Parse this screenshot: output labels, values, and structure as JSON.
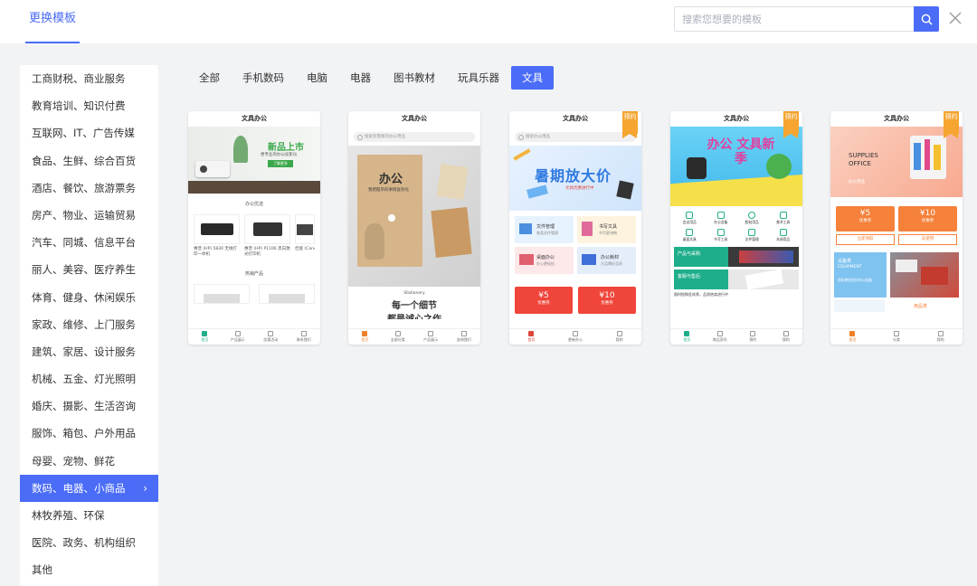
{
  "header": {
    "tab_label": "更换模板",
    "search_placeholder": "搜索您想要的模板"
  },
  "sidebar": {
    "items": [
      {
        "label": "工商财税、商业服务"
      },
      {
        "label": "教育培训、知识付费"
      },
      {
        "label": "互联网、IT、广告传媒"
      },
      {
        "label": "食品、生鲜、综合百货"
      },
      {
        "label": "酒店、餐饮、旅游票务"
      },
      {
        "label": "房产、物业、运输贸易"
      },
      {
        "label": "汽车、同城、信息平台"
      },
      {
        "label": "丽人、美容、医疗养生"
      },
      {
        "label": "体育、健身、休闲娱乐"
      },
      {
        "label": "家政、维修、上门服务"
      },
      {
        "label": "建筑、家居、设计服务"
      },
      {
        "label": "机械、五金、灯光照明"
      },
      {
        "label": "婚庆、摄影、生活咨询"
      },
      {
        "label": "服饰、箱包、户外用品"
      },
      {
        "label": "母婴、宠物、鲜花"
      },
      {
        "label": "数码、电器、小商品",
        "active": true
      },
      {
        "label": "林牧养殖、环保"
      },
      {
        "label": "医院、政务、机构组织"
      },
      {
        "label": "其他"
      }
    ]
  },
  "filters": {
    "tabs": [
      {
        "label": "全部"
      },
      {
        "label": "手机数码"
      },
      {
        "label": "电脑"
      },
      {
        "label": "电器"
      },
      {
        "label": "图书教材"
      },
      {
        "label": "玩具乐器"
      },
      {
        "label": "文具",
        "active": true
      }
    ]
  },
  "cards": [
    {
      "title": "文具办公",
      "banner_title": "新品上市",
      "banner_sub": "更专业的办公投影仪",
      "banner_btn": "了解更多",
      "section1": "办公优选",
      "products": [
        {
          "name": "惠普 (HP) 5830 无线打印一体机"
        },
        {
          "name": "惠普 (HP) P1106 黑白激光打印机"
        },
        {
          "name": "佳能 (Canon) 针式打印机"
        }
      ],
      "section2": "热销产品",
      "tabbar": [
        "首页",
        "产品展示",
        "优惠活动",
        "联系我们"
      ]
    },
    {
      "title": "文具办公",
      "search": "搜索您需要的办公用品",
      "banner_title": "办公",
      "banner_sub": "我把握单的事情复杂化",
      "tag": "Stationery",
      "caption1": "每一个细节",
      "caption2": "都是诚心之作",
      "tabbar": [
        "首页",
        "全部分类",
        "产品展示",
        "咨询我们"
      ]
    },
    {
      "title": "文具办公",
      "ribbon": "预约",
      "search": "搜索办公用品",
      "banner_title": "暑期放大价",
      "banner_sub": "文具优惠进行中",
      "grid": [
        {
          "name": "文件管理",
          "sub": "各类文件管理"
        },
        {
          "name": "书写文具",
          "sub": "书写更流畅"
        },
        {
          "name": "桌面办公",
          "sub": "办公更轻松"
        },
        {
          "name": "办公耗材",
          "sub": "大品牌好品质"
        }
      ],
      "coupons": [
        {
          "amount": "¥5",
          "label": "优惠券"
        },
        {
          "amount": "¥10",
          "label": "优惠券"
        }
      ],
      "tabbar": [
        "首页",
        "更新办公",
        "我的"
      ]
    },
    {
      "title": "文具办公",
      "ribbon": "预约",
      "banner_title": "办公 文具新季",
      "icons": [
        "会议用品",
        "办公设备",
        "胶粘用品",
        "美术工具",
        "桌面文具",
        "书写工具",
        "文件管理",
        "本册用品"
      ],
      "promo1": "产品与采购",
      "promo2": "客服与售后",
      "notice": "限时抢购狂欢季，品质热卖进行中",
      "tabbar": [
        "首页",
        "商品资讯",
        "预约",
        "我的"
      ]
    },
    {
      "title": "文具办公",
      "ribbon": "预约",
      "banner_title1": "SUPPLIES",
      "banner_title2": "OFFICE",
      "banner_sub": "办公用品",
      "coupons": [
        {
          "amount": "¥5",
          "label": "优惠券",
          "btn": "立即领取"
        },
        {
          "amount": "¥10",
          "label": "优惠券",
          "btn": "去使用"
        }
      ],
      "equip_title": "设备类",
      "equip_en": "EQUIPMENT",
      "equip_sub": "质优感优良好办公设备",
      "label2": "用品类",
      "tabbar": [
        "首页",
        "分类",
        "我的"
      ]
    }
  ],
  "colors": {
    "accent": "#4a6cf7",
    "orange": "#f08028",
    "teal": "#1fae8b",
    "red": "#f0453a"
  }
}
